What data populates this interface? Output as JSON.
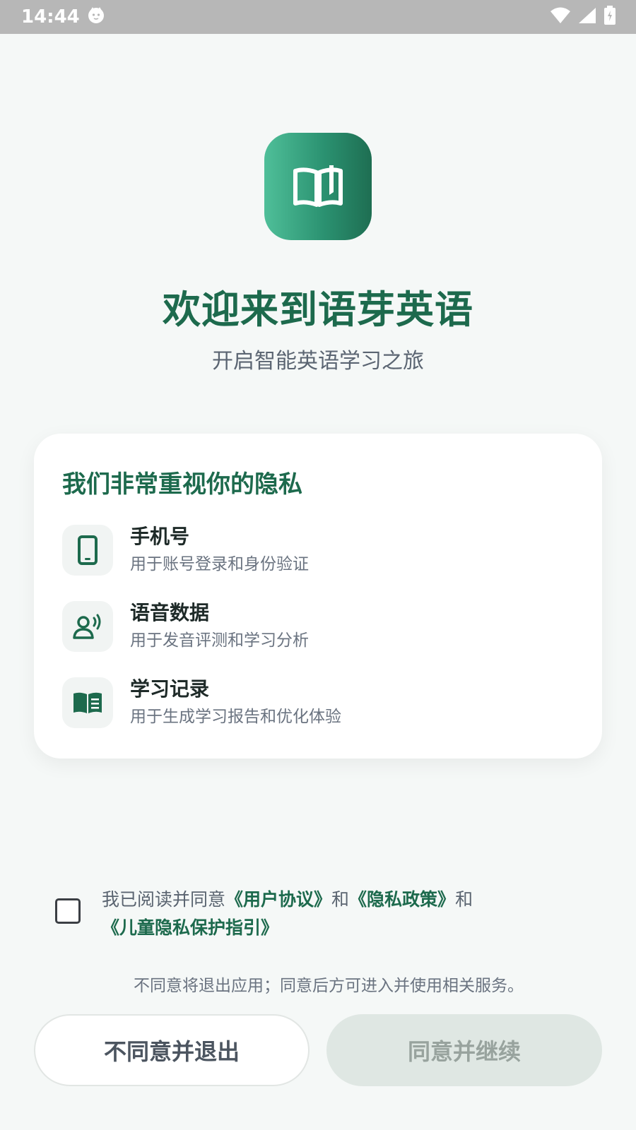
{
  "status_bar": {
    "time": "14:44"
  },
  "header": {
    "title": "欢迎来到语芽英语",
    "subtitle": "开启智能英语学习之旅"
  },
  "privacy_card": {
    "title": "我们非常重视你的隐私",
    "items": [
      {
        "icon": "phone-icon",
        "title": "手机号",
        "desc": "用于账号登录和身份验证"
      },
      {
        "icon": "voice-user-icon",
        "title": "语音数据",
        "desc": "用于发音评测和学习分析"
      },
      {
        "icon": "book-icon",
        "title": "学习记录",
        "desc": "用于生成学习报告和优化体验"
      }
    ]
  },
  "consent": {
    "checked": false,
    "prefix": "我已阅读并同意",
    "link_user_agreement": "《用户协议》",
    "and1": "和",
    "link_privacy_policy": "《隐私政策》",
    "and2": "和",
    "link_child_privacy": "《儿童隐私保护指引》"
  },
  "note": "不同意将退出应用；同意后方可进入并使用相关服务。",
  "buttons": {
    "decline": "不同意并退出",
    "accept": "同意并继续"
  },
  "colors": {
    "brand": "#1d6a4d",
    "accent_gradient_start": "#4fbf99",
    "accent_gradient_end": "#1e6e52",
    "accept_disabled_bg": "#dfe7e3"
  }
}
